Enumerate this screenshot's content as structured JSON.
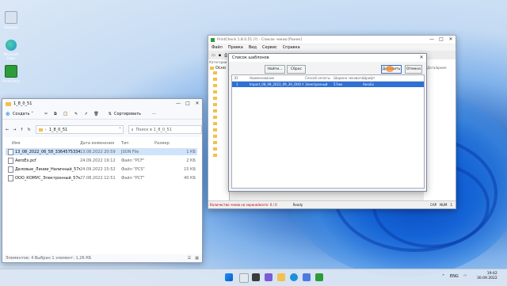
{
  "desktop": {
    "icons": [
      {
        "label": "Корзина",
        "color": "#d8e2ee"
      },
      {
        "label": "Microsoft Edge",
        "color": "#1f8fd6"
      },
      {
        "label": "PrintCheck",
        "color": "#2e9b3a"
      }
    ]
  },
  "explorer": {
    "title": "1_8_0_51",
    "create_label": "Создать",
    "sort_label": "Сортировать",
    "path": [
      "1_8_0_51"
    ],
    "search_placeholder": "Поиск в 1_8_0_51",
    "columns": [
      "Имя",
      "Дата изменения",
      "Тип",
      "Размер"
    ],
    "files": [
      {
        "name": "13_08_2022_06_58_336457533416051084049",
        "date": "13.08.2022 20:59",
        "type": "JSON File",
        "size": "1 КБ",
        "selected": true
      },
      {
        "name": "AeroEx.pcf",
        "date": "24.09.2022 19:12",
        "type": "Файл \"PCF\"",
        "size": "2 КБ",
        "selected": false
      },
      {
        "name": "Деловые_Линии_Наличный_57мм_v1_8...",
        "date": "24.09.2022 15:52",
        "type": "Файл \"PCS\"",
        "size": "15 КБ",
        "selected": false
      },
      {
        "name": "ООО_КОМУС_Электронный_57мм_v1_8...",
        "date": "27.08.2022 12:51",
        "type": "Файл \"PCT\"",
        "size": "40 КБ",
        "selected": false
      }
    ],
    "status": "Элементов: 4    Выбран 1 элемент: 1,26 КБ"
  },
  "app": {
    "title": "PrintCheck 1.8.0.51 (?) - Список чеков [Ранее]",
    "menu": [
      "Файл",
      "Правка",
      "Вид",
      "Сервис",
      "Справка"
    ],
    "left_header": "Категории",
    "left_item": "Осно",
    "right_header": "Дата/время",
    "status_left": "Количество чеков на экране/всего: 0 / 0",
    "status_mid": "Ready",
    "status_right": [
      "CAP",
      "NUM",
      "1"
    ]
  },
  "dialog": {
    "title": "Список шаблонов",
    "find_label": "Найти...",
    "reset_label": "Сброс",
    "add_label": "Добавить",
    "cancel_label": "Отмена",
    "columns": [
      "ID",
      "Наименование",
      "Способ оплаты",
      "Ширина чекового...",
      "Шрифт"
    ],
    "rows": [
      {
        "id": "1",
        "name": "Import_08_09_2022_09_39_OOO КОМУС_Э...",
        "pay": "Электронный",
        "width": "57мм",
        "font": "AeroEx",
        "selected": true
      }
    ]
  },
  "taskbar": {
    "lang": "ENG",
    "time": "19:42",
    "date": "30.09.2022"
  }
}
